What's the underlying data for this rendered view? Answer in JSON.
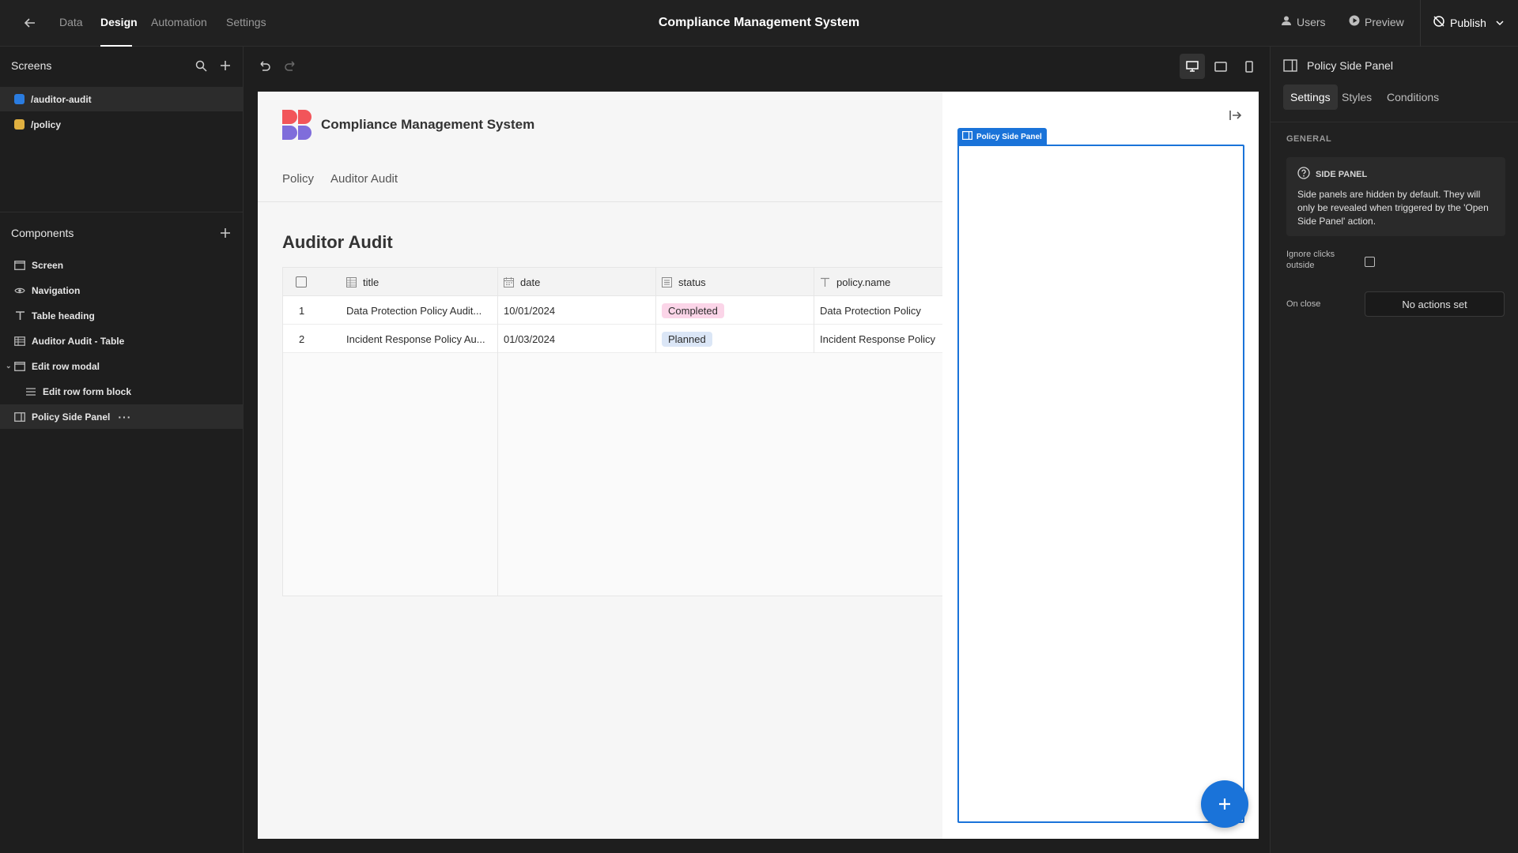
{
  "topbar": {
    "tabs": [
      "Data",
      "Design",
      "Automation",
      "Settings"
    ],
    "title": "Compliance Management System",
    "users_label": "Users",
    "preview_label": "Preview",
    "publish_label": "Publish"
  },
  "screens": {
    "heading": "Screens",
    "items": [
      {
        "label": "/auditor-audit",
        "color": "#2a7ce0"
      },
      {
        "label": "/policy",
        "color": "#e0b040"
      }
    ]
  },
  "components": {
    "heading": "Components",
    "items": [
      {
        "label": "Screen",
        "icon": "screen-icon"
      },
      {
        "label": "Navigation",
        "icon": "eye-icon"
      },
      {
        "label": "Table heading",
        "icon": "text-icon"
      },
      {
        "label": "Auditor Audit - Table",
        "icon": "table-icon"
      },
      {
        "label": "Edit row modal",
        "icon": "modal-icon"
      },
      {
        "label": "Edit row form block",
        "icon": "form-icon"
      },
      {
        "label": "Policy Side Panel",
        "icon": "side-panel-icon"
      }
    ]
  },
  "canvas": {
    "app_title": "Compliance Management System",
    "nav": [
      "Policy",
      "Auditor Audit"
    ],
    "page_title": "Auditor Audit",
    "table": {
      "columns": [
        "title",
        "date",
        "status",
        "policy.name"
      ],
      "rows": [
        {
          "num": "1",
          "title": "Data Protection Policy Audit...",
          "date": "10/01/2024",
          "status": "Completed",
          "policy": "Data Protection Policy"
        },
        {
          "num": "2",
          "title": "Incident Response Policy Au...",
          "date": "01/03/2024",
          "status": "Planned",
          "policy": "Incident Response Policy"
        }
      ]
    },
    "side_panel_tag": "Policy Side Panel"
  },
  "settings": {
    "title": "Policy Side Panel",
    "tabs": [
      "Settings",
      "Styles",
      "Conditions"
    ],
    "section": "GENERAL",
    "info_title": "SIDE PANEL",
    "info_body": "Side panels are hidden by default. They will only be revealed when triggered by the 'Open Side Panel' action.",
    "ignore_label": "Ignore clicks outside",
    "on_close_label": "On close",
    "on_close_value": "No actions set"
  },
  "colors": {
    "accent": "#1a73d9",
    "completed_bg": "#fbd5e8",
    "planned_bg": "#dbe6f6"
  }
}
